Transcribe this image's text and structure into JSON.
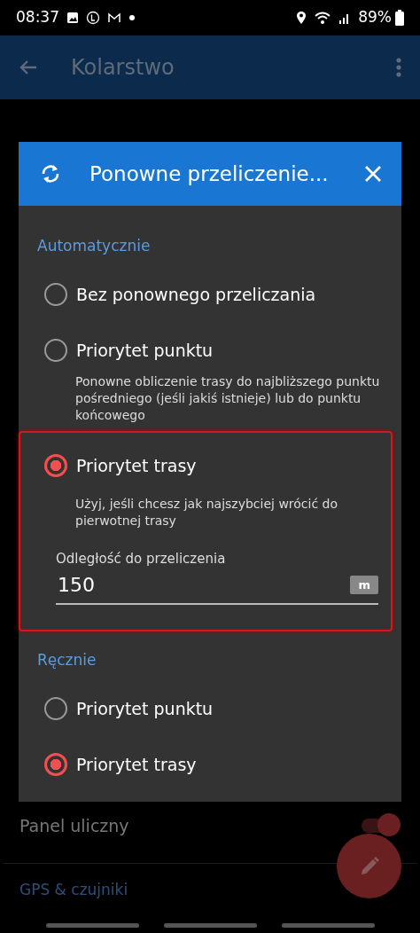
{
  "status_bar": {
    "time": "08:37",
    "battery": "89%"
  },
  "app_bar": {
    "title": "Kolarstwo"
  },
  "dialog": {
    "title": "Ponowne przeliczenie...",
    "sections": [
      {
        "header": "Automatycznie",
        "options": [
          {
            "label": "Bez ponownego przeliczania",
            "selected": false
          },
          {
            "label": "Priorytet punktu",
            "selected": false,
            "description": "Ponowne obliczenie trasy do najbliższego punktu pośredniego (jeśli jakiś istnieje) lub do punktu końcowego"
          },
          {
            "label": "Priorytet trasy",
            "selected": true,
            "highlighted": true,
            "description": "Użyj, jeśli chcesz jak najszybciej wrócić do pierwotnej trasy",
            "field": {
              "label": "Odległość do przeliczenia",
              "value": "150",
              "unit": "m"
            }
          }
        ]
      },
      {
        "header": "Ręcznie",
        "options": [
          {
            "label": "Priorytet punktu",
            "selected": false
          },
          {
            "label": "Priorytet trasy",
            "selected": true
          }
        ]
      }
    ]
  },
  "settings": [
    {
      "kind": "toggle",
      "label": "Panel uliczny",
      "on": true
    },
    {
      "kind": "header",
      "label": "GPS & czujniki"
    }
  ]
}
